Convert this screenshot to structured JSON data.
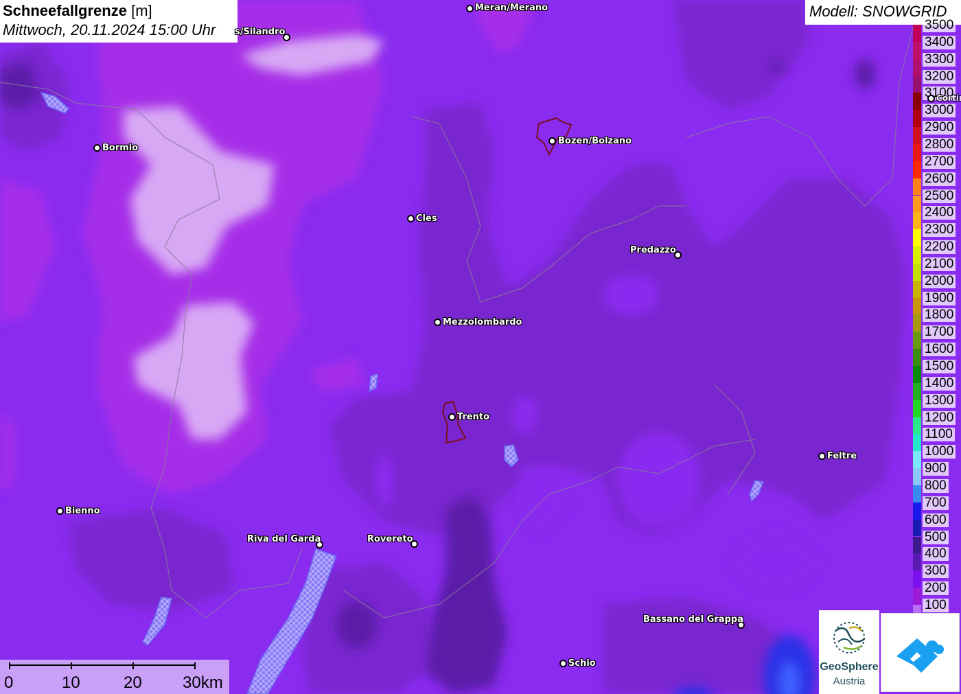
{
  "header": {
    "title": "Schneefallgrenze",
    "unit": "[m]",
    "datetime": "Mittwoch, 20.11.2024 15:00 Uhr"
  },
  "model": {
    "label": "Modell: SNOWGRID"
  },
  "legend": {
    "items": [
      {
        "label": "3500",
        "color": "#c2005a"
      },
      {
        "label": "3400",
        "color": "#c0106a"
      },
      {
        "label": "3300",
        "color": "#b0106e"
      },
      {
        "label": "3200",
        "color": "#981070"
      },
      {
        "label": "3100",
        "color": "#8b0000"
      },
      {
        "label": "3000",
        "color": "#b00010"
      },
      {
        "label": "2900",
        "color": "#d01020"
      },
      {
        "label": "2800",
        "color": "#e81818"
      },
      {
        "label": "2700",
        "color": "#ff2a00"
      },
      {
        "label": "2600",
        "color": "#ff7f1a"
      },
      {
        "label": "2500",
        "color": "#ff9a1a"
      },
      {
        "label": "2400",
        "color": "#ffb31a"
      },
      {
        "label": "2300",
        "color": "#ffff00"
      },
      {
        "label": "2200",
        "color": "#d8f000"
      },
      {
        "label": "2100",
        "color": "#c4e000"
      },
      {
        "label": "2000",
        "color": "#c8b400"
      },
      {
        "label": "1900",
        "color": "#c8960a"
      },
      {
        "label": "1800",
        "color": "#a89a10"
      },
      {
        "label": "1700",
        "color": "#6a9a10"
      },
      {
        "label": "1600",
        "color": "#3c8c10"
      },
      {
        "label": "1500",
        "color": "#0a8a0a"
      },
      {
        "label": "1400",
        "color": "#22b022"
      },
      {
        "label": "1300",
        "color": "#22d822"
      },
      {
        "label": "1200",
        "color": "#2ae88c"
      },
      {
        "label": "1100",
        "color": "#24e8c8"
      },
      {
        "label": "1000",
        "color": "#7ae8f8"
      },
      {
        "label": "900",
        "color": "#8ac8f8"
      },
      {
        "label": "800",
        "color": "#3a8af0"
      },
      {
        "label": "700",
        "color": "#1a1aee"
      },
      {
        "label": "600",
        "color": "#1a1ab0"
      },
      {
        "label": "500",
        "color": "#3a1a88"
      },
      {
        "label": "400",
        "color": "#5a1ab0"
      },
      {
        "label": "300",
        "color": "#7a10f0"
      },
      {
        "label": "200",
        "color": "#9a1ad8"
      },
      {
        "label": "100",
        "color": "#b870f8"
      }
    ]
  },
  "cities": [
    {
      "name": "Meran/Merano"
    },
    {
      "name": "s/Silandro"
    },
    {
      "name": "Bormio"
    },
    {
      "name": "Bozen/Bolzano"
    },
    {
      "name": "Cles"
    },
    {
      "name": "Predazzo"
    },
    {
      "name": "Cortin"
    },
    {
      "name": "Mezzolombardo"
    },
    {
      "name": "Trento"
    },
    {
      "name": "Feltre"
    },
    {
      "name": "Bienno"
    },
    {
      "name": "Riva del Garda"
    },
    {
      "name": "Rovereto"
    },
    {
      "name": "Bassano del Grappa"
    },
    {
      "name": "Schio"
    }
  ],
  "scalebar": {
    "ticks": [
      "0",
      "10",
      "20",
      "30km"
    ]
  },
  "logos": {
    "geosphere_line1": "GeoSphere",
    "geosphere_line2": "Austria"
  }
}
